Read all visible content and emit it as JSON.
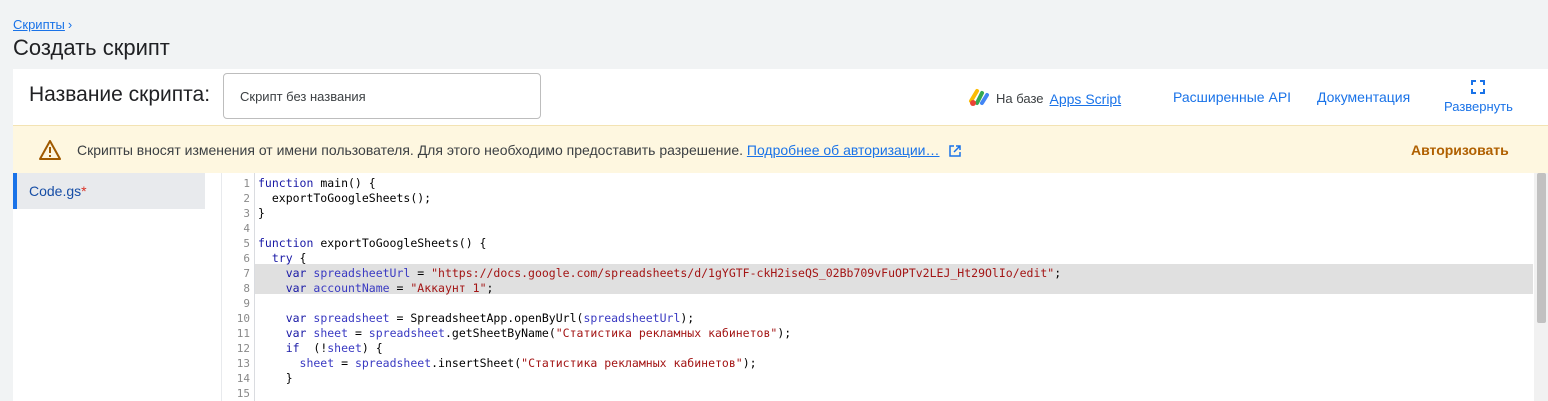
{
  "breadcrumb": {
    "label": "Скрипты",
    "chevron": "›"
  },
  "page_title": "Создать скрипт",
  "header": {
    "name_label": "Название скрипта:",
    "name_value": "Скрипт без названия",
    "apps_script_prefix": "На базе",
    "apps_script_link": "Apps Script",
    "advanced_api": "Расширенные API",
    "documentation": "Документация",
    "expand": "Развернуть"
  },
  "warning": {
    "message": "Скрипты вносят изменения от имени пользователя. Для этого необходимо предоставить разрешение.",
    "learn_more": "Подробнее об авторизации…",
    "authorize": "Авторизовать"
  },
  "files": [
    {
      "name": "Code.gs",
      "unsaved_mark": "*"
    }
  ],
  "colors": {
    "accent": "#1a73e8",
    "warning_bg": "#fef7e0",
    "authorize": "#b06000"
  },
  "editor": {
    "line_numbers": [
      "1",
      "2",
      "3",
      "4",
      "5",
      "6",
      "7",
      "8",
      "9",
      "10",
      "11",
      "12",
      "13",
      "14",
      "15"
    ],
    "lines": [
      [
        [
          "kw",
          "function"
        ],
        [
          "",
          "main() {"
        ]
      ],
      [
        [
          "",
          "  exportToGoogleSheets();"
        ]
      ],
      [
        [
          "",
          "}"
        ]
      ],
      [
        [
          "",
          ""
        ]
      ],
      [
        [
          "kw",
          "function"
        ],
        [
          "",
          "exportToGoogleSheets() {"
        ]
      ],
      [
        [
          "kw",
          "  try"
        ],
        [
          "",
          "{"
        ]
      ],
      [
        [
          "kw",
          "    var"
        ],
        [
          "vr",
          "spreadsheetUrl"
        ],
        [
          "",
          " = "
        ],
        [
          "st",
          "\"https://docs.google.com/spreadsheets/d/1gYGTF-ckH2iseQS_02Bb709vFuOPTv2LEJ_Ht29OlIo/edit\""
        ],
        [
          "",
          ";"
        ]
      ],
      [
        [
          "kw",
          "    var"
        ],
        [
          "vr",
          "accountName"
        ],
        [
          "",
          " = "
        ],
        [
          "st",
          "\"Аккаунт 1\""
        ],
        [
          "",
          ";"
        ]
      ],
      [
        [
          "",
          ""
        ]
      ],
      [
        [
          "kw",
          "    var"
        ],
        [
          "vr",
          "spreadsheet"
        ],
        [
          "",
          " = SpreadsheetApp.openByUrl("
        ],
        [
          "vr",
          "spreadsheetUrl"
        ],
        [
          "",
          ");"
        ]
      ],
      [
        [
          "kw",
          "    var"
        ],
        [
          "vr",
          "sheet"
        ],
        [
          "",
          " = "
        ],
        [
          "vr",
          "spreadsheet"
        ],
        [
          "",
          ".getSheetByName("
        ],
        [
          "st",
          "\"Статистика рекламных кабинетов\""
        ],
        [
          "",
          ");"
        ]
      ],
      [
        [
          "kw",
          "    if"
        ],
        [
          "",
          " (!"
        ],
        [
          "vr",
          "sheet"
        ],
        [
          "",
          ") {"
        ]
      ],
      [
        [
          "vr",
          "      sheet"
        ],
        [
          "",
          " = "
        ],
        [
          "vr",
          "spreadsheet"
        ],
        [
          "",
          ".insertSheet("
        ],
        [
          "st",
          "\"Статистика рекламных кабинетов\""
        ],
        [
          "",
          ");"
        ]
      ],
      [
        [
          "",
          "    }"
        ]
      ],
      [
        [
          "",
          ""
        ]
      ]
    ]
  }
}
